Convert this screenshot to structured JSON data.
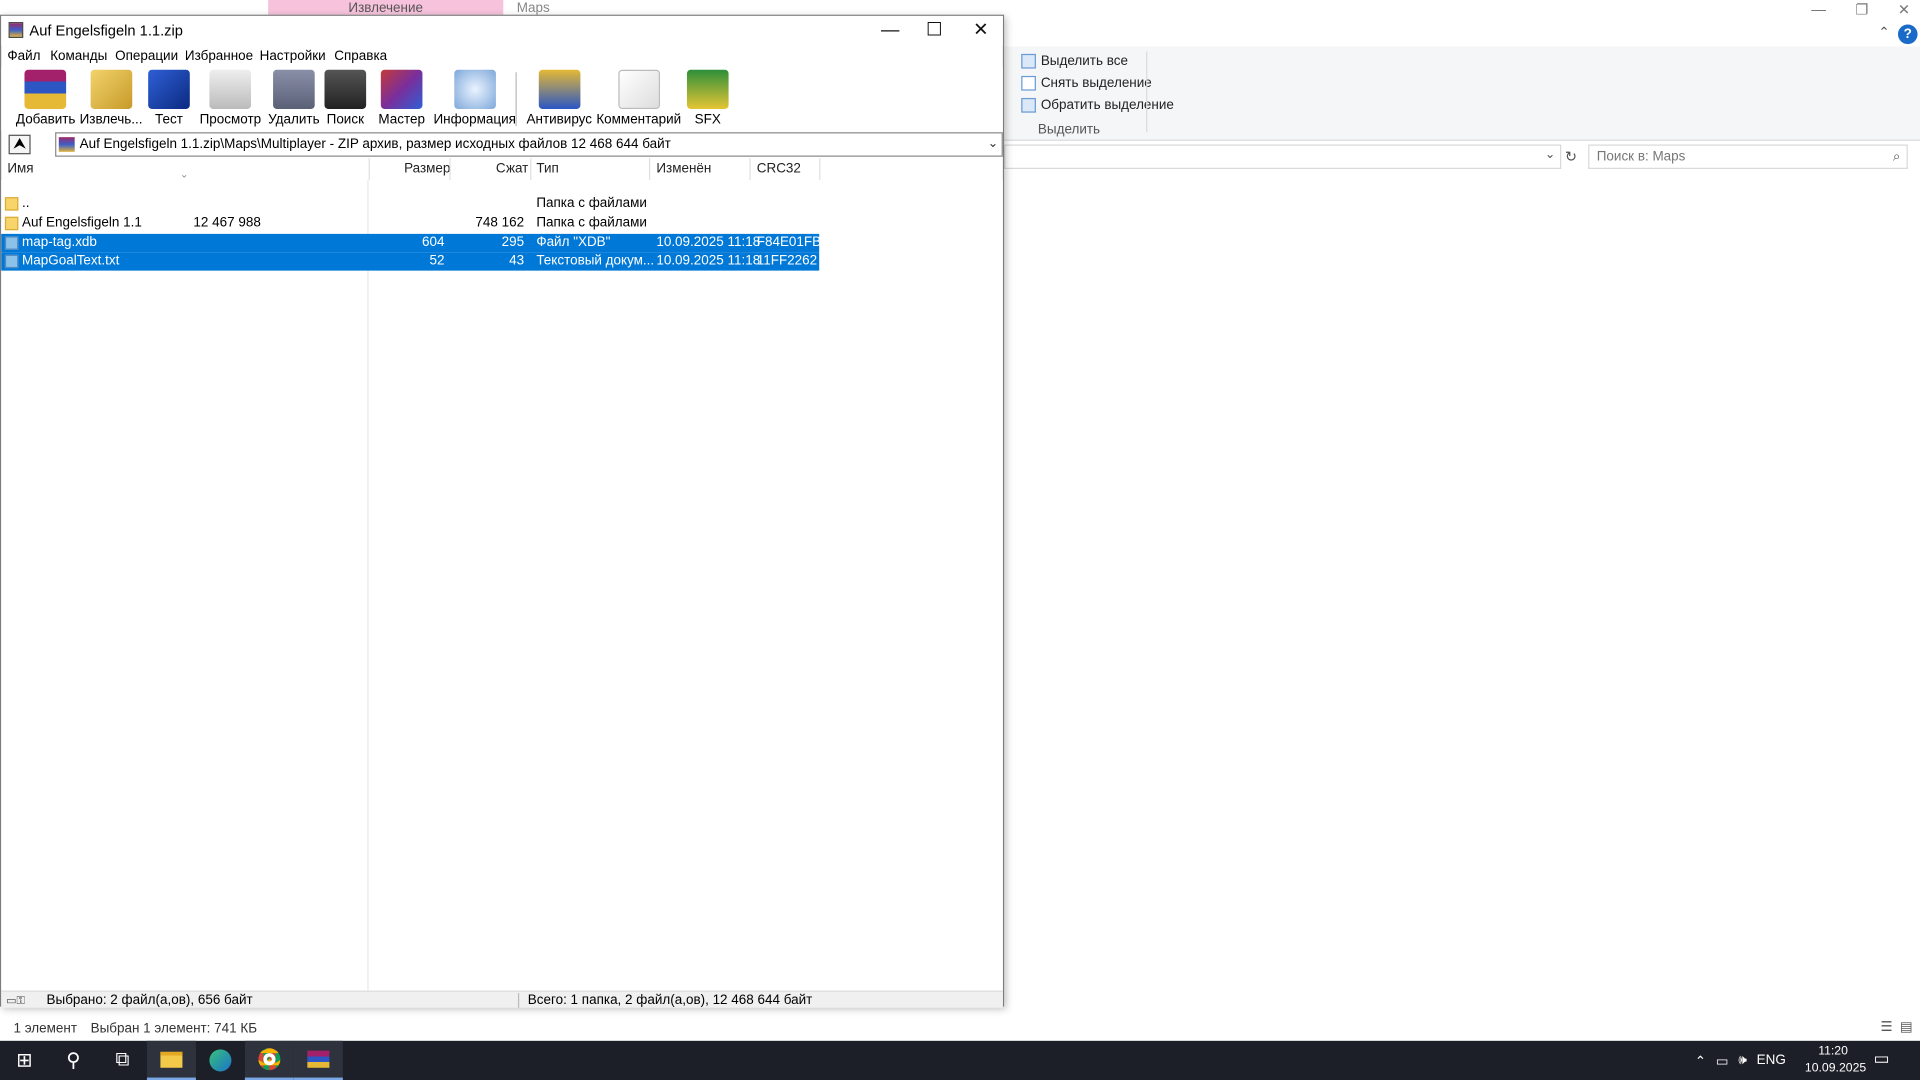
{
  "explorer": {
    "tab_active": "Извлечение",
    "tab_other": "Maps",
    "ribbon": {
      "select_all": "Выделить все",
      "deselect": "Снять выделение",
      "invert": "Обратить выделение",
      "group_label": "Выделить"
    },
    "search_placeholder": "Поиск в: Maps",
    "status_count": "1 элемент",
    "status_selected": "Выбран 1 элемент: 741 КБ"
  },
  "rar": {
    "title": "Auf Engelsfigeln 1.1.zip",
    "menu": [
      "Файл",
      "Команды",
      "Операции",
      "Избранное",
      "Настройки",
      "Справка"
    ],
    "toolbar": [
      "Добавить",
      "Извлечь...",
      "Тест",
      "Просмотр",
      "Удалить",
      "Поиск",
      "Мастер",
      "Информация",
      "Антивирус",
      "Комментарий",
      "SFX"
    ],
    "path": "Auf Engelsfigeln 1.1.zip\\Maps\\Multiplayer - ZIP архив, размер исходных файлов 12 468 644 байт",
    "columns": {
      "name": "Имя",
      "size": "Размер",
      "packed": "Сжат",
      "type": "Тип",
      "modified": "Изменён",
      "crc": "CRC32"
    },
    "rows": [
      {
        "name": "..",
        "size": "",
        "packed": "",
        "type": "Папка с файлами",
        "modified": "",
        "crc": ""
      },
      {
        "name": "Auf Engelsfigeln 1.1",
        "size": "12 467 988",
        "packed": "748 162",
        "type": "Папка с файлами",
        "modified": "",
        "crc": ""
      },
      {
        "name": "map-tag.xdb",
        "size": "604",
        "packed": "295",
        "type": "Файл \"XDB\"",
        "modified": "10.09.2025 11:18",
        "crc": "F84E01FB"
      },
      {
        "name": "MapGoalText.txt",
        "size": "52",
        "packed": "43",
        "type": "Текстовый докум...",
        "modified": "10.09.2025 11:18",
        "crc": "11FF2262"
      }
    ],
    "status_left": "Выбрано: 2 файл(а,ов), 656 байт",
    "status_right": "Всего: 1 папка, 2 файл(а,ов), 12 468 644 байт"
  },
  "taskbar": {
    "lang": "ENG",
    "time": "11:20",
    "date": "10.09.2025"
  }
}
